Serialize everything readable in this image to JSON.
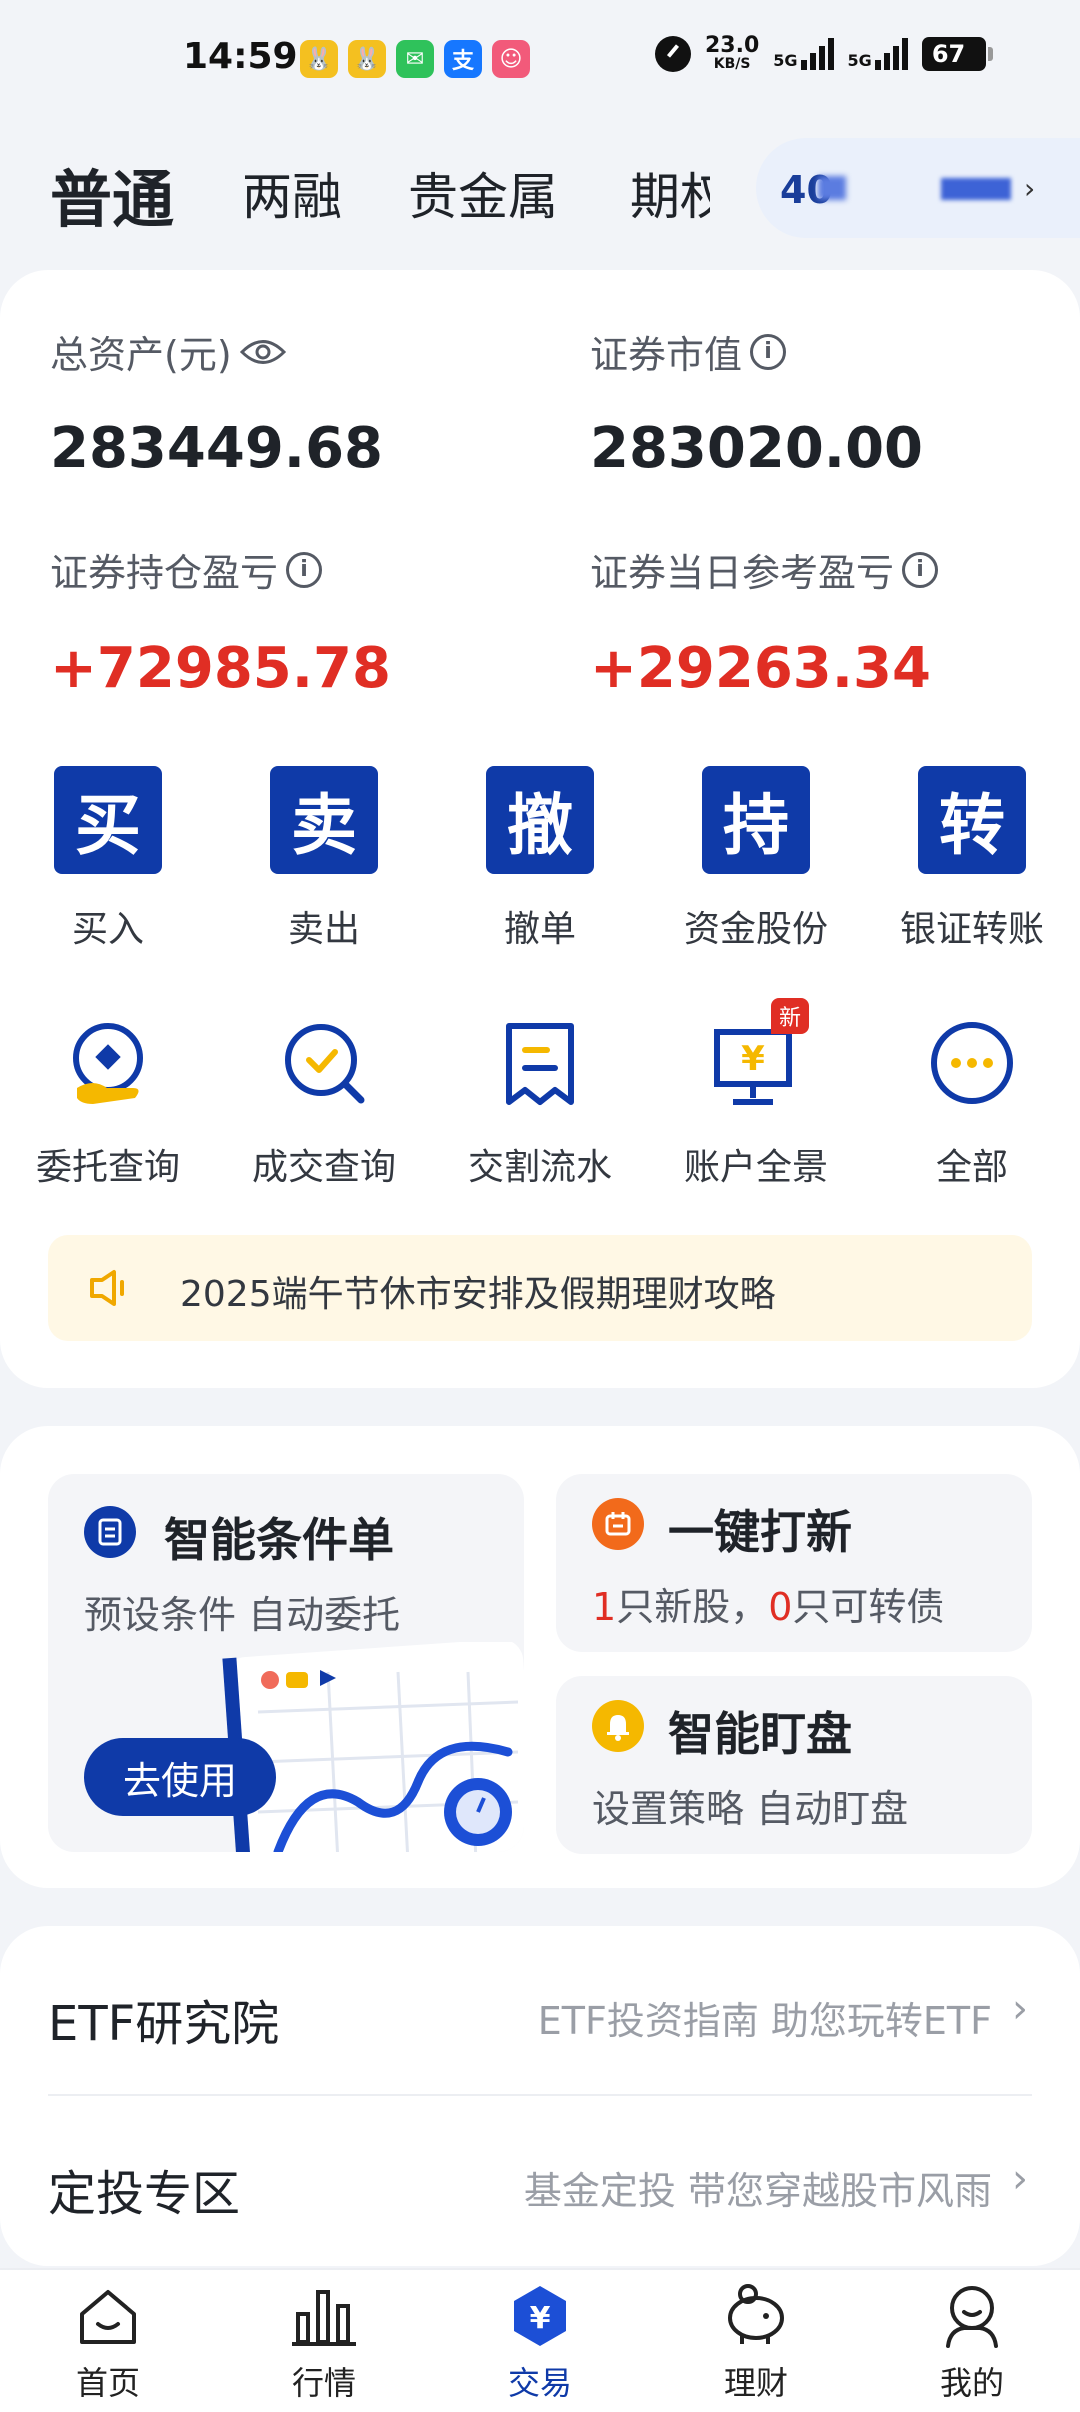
{
  "status_bar": {
    "time": "14:59",
    "net_speed": "23.0",
    "net_unit": "KB/S",
    "signal1": "5G",
    "signal2": "5G",
    "battery": "67"
  },
  "tabs": [
    {
      "label": "普通",
      "active": true
    },
    {
      "label": "两融"
    },
    {
      "label": "贵金属"
    },
    {
      "label": "期权"
    }
  ],
  "account": {
    "masked_prefix": "40"
  },
  "summary": {
    "total_assets_label": "总资产(元)",
    "total_assets_value": "283449.68",
    "market_value_label": "证券市值",
    "market_value_value": "283020.00",
    "position_pl_label": "证券持仓盈亏",
    "position_pl_value": "+72985.78",
    "daily_pl_label": "证券当日参考盈亏",
    "daily_pl_value": "+29263.34"
  },
  "quick_actions": [
    {
      "glyph": "买",
      "label": "买入"
    },
    {
      "glyph": "卖",
      "label": "卖出"
    },
    {
      "glyph": "撤",
      "label": "撤单"
    },
    {
      "glyph": "持",
      "label": "资金股份"
    },
    {
      "glyph": "转",
      "label": "银证转账"
    }
  ],
  "tools": [
    {
      "label": "委托查询",
      "icon": "order-query-icon"
    },
    {
      "label": "成交查询",
      "icon": "deal-query-icon"
    },
    {
      "label": "交割流水",
      "icon": "settlement-icon"
    },
    {
      "label": "账户全景",
      "icon": "account-overview-icon",
      "badge": "新"
    },
    {
      "label": "全部",
      "icon": "more-icon"
    }
  ],
  "notice": {
    "text": "2025端午节休市安排及假期理财攻略"
  },
  "features": {
    "smart_order": {
      "title": "智能条件单",
      "subtitle": "预设条件 自动委托",
      "button": "去使用"
    },
    "ipo": {
      "title": "一键打新",
      "count_stock": "1",
      "stock_text": "只新股，",
      "count_bond": "0",
      "bond_text": "只可转债"
    },
    "monitor": {
      "title": "智能盯盘",
      "subtitle": "设置策略 自动盯盘"
    }
  },
  "list_rows": [
    {
      "title": "ETF研究院",
      "subtitle": "ETF投资指南 助您玩转ETF"
    },
    {
      "title": "定投专区",
      "subtitle": "基金定投 带您穿越股市风雨"
    }
  ],
  "bottom_nav": [
    {
      "label": "首页"
    },
    {
      "label": "行情"
    },
    {
      "label": "交易",
      "active": true
    },
    {
      "label": "理财"
    },
    {
      "label": "我的"
    }
  ],
  "colors": {
    "brand_blue": "#0f3aa8",
    "gain_red": "#e02e24",
    "notice_bg": "#fff8e5"
  }
}
